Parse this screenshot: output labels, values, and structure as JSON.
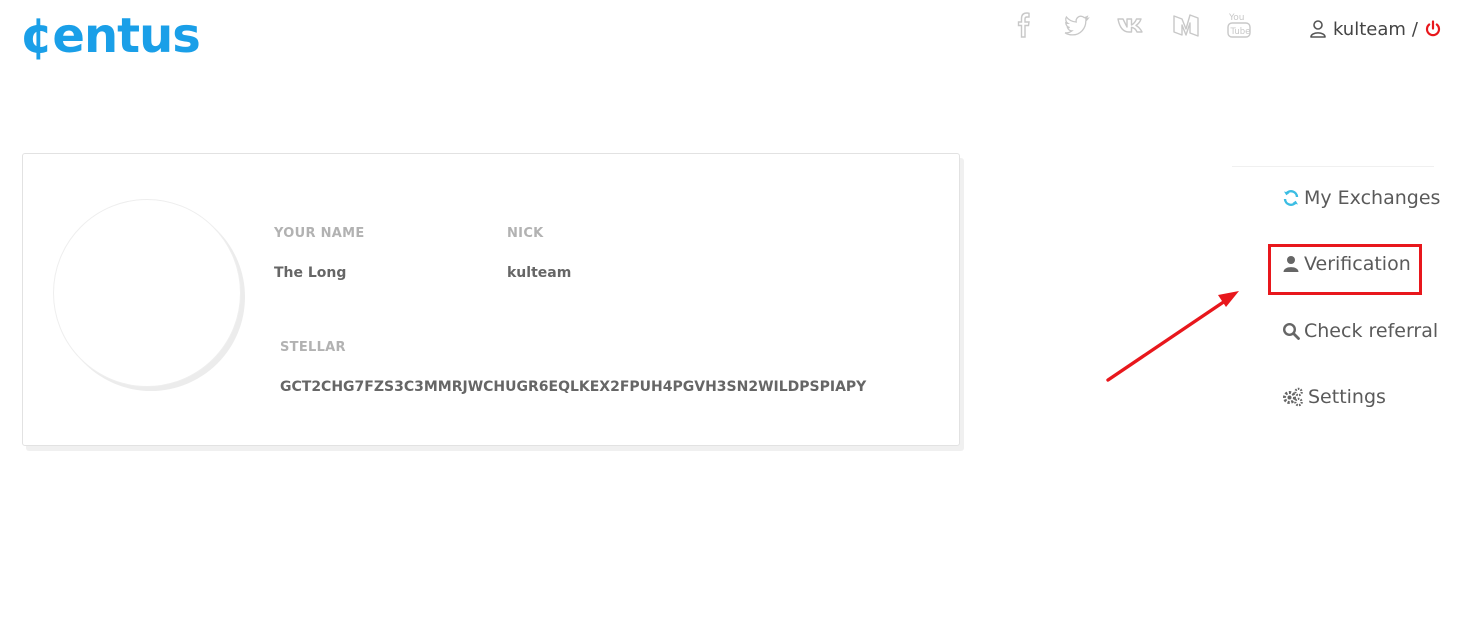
{
  "header": {
    "logo_text": "¢entus",
    "brand_color": "#1a9fe8",
    "social_links": [
      {
        "icon": "facebook-icon"
      },
      {
        "icon": "twitter-icon"
      },
      {
        "icon": "vk-icon"
      },
      {
        "icon": "medium-icon"
      },
      {
        "icon": "youtube-icon"
      }
    ],
    "user": {
      "username": "kulteam",
      "separator": "/",
      "logout_icon": "power-icon",
      "logout_color": "#e8171c"
    }
  },
  "profile": {
    "name_label": "YOUR NAME",
    "name_value": "The Long",
    "nick_label": "NICK",
    "nick_value": "kulteam",
    "stellar_label": "STELLAR",
    "stellar_value": "GCT2CHG7FZS3C3MMRJWCHUGR6EQLKEX2FPUH4PGVH3SN2WILDPSPIAPY"
  },
  "side_menu": {
    "items": [
      {
        "label": "My Exchanges",
        "icon": "refresh-icon",
        "icon_color": "#3bbde3"
      },
      {
        "label": "Verification",
        "icon": "user-icon",
        "highlighted": true
      },
      {
        "label": "Check referral",
        "icon": "search-icon"
      },
      {
        "label": "Settings",
        "icon": "gears-icon"
      }
    ]
  },
  "annotation": {
    "highlight_color": "#e8171c",
    "arrow_color": "#e8171c"
  }
}
